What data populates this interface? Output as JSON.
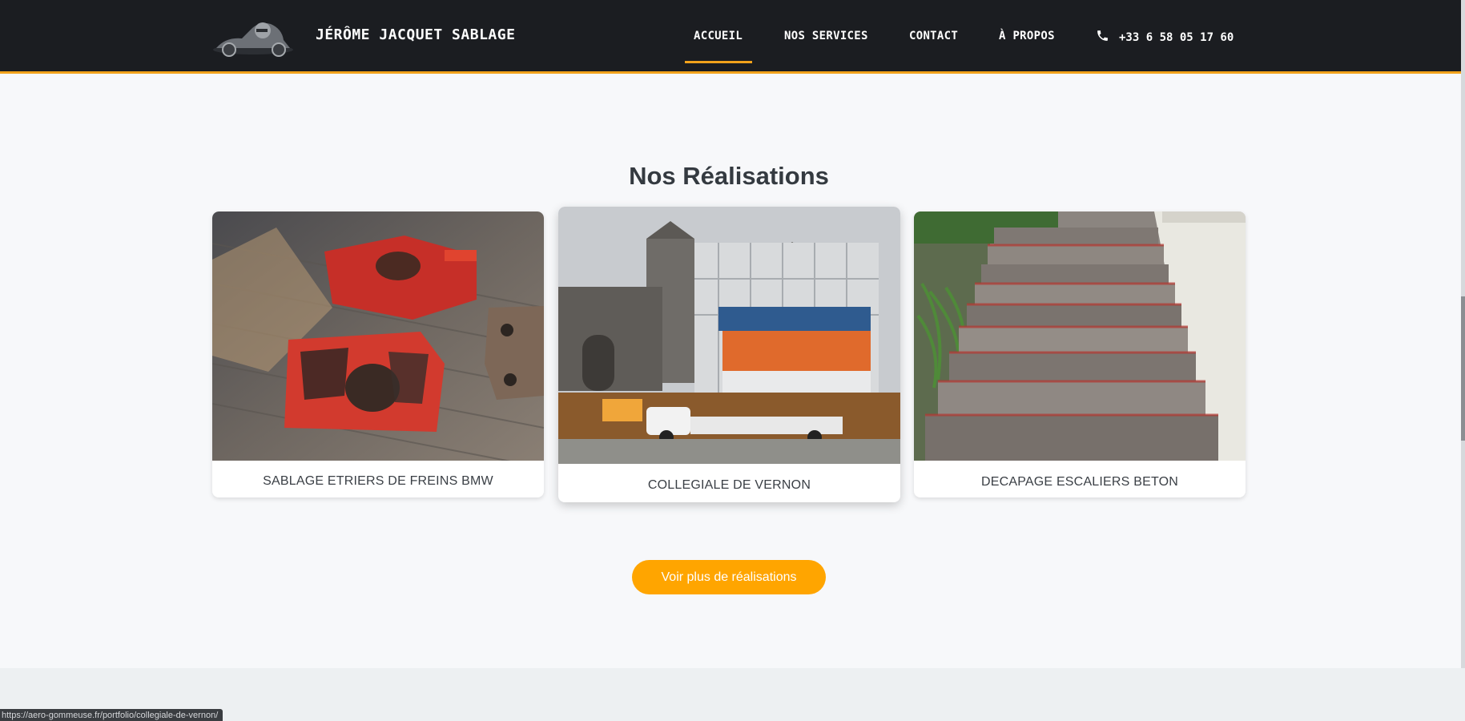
{
  "header": {
    "brand": "JÉRÔME JACQUET SABLAGE",
    "logo_icon": "motorcycle-rider-logo",
    "nav": [
      {
        "label": "ACCUEIL",
        "active": true
      },
      {
        "label": "NOS SERVICES",
        "active": false
      },
      {
        "label": "CONTACT",
        "active": false
      },
      {
        "label": "À PROPOS",
        "active": false
      }
    ],
    "phone": "+33 6 58 05 17 60",
    "phone_icon": "phone-icon",
    "accent_color": "#f2a21b"
  },
  "section": {
    "title": "Nos Réalisations",
    "cards": [
      {
        "caption": "SABLAGE ETRIERS DE FREINS BMW",
        "image": "red-brake-calipers-photo"
      },
      {
        "caption": "COLLEGIALE DE VERNON",
        "image": "scaffolded-church-photo"
      },
      {
        "caption": "DECAPAGE ESCALIERS BETON",
        "image": "concrete-stairs-photo"
      }
    ],
    "more_button": "Voir plus de réalisations",
    "button_color": "#ffa500"
  },
  "status_bar": {
    "url": "https://aero-gommeuse.fr/portfolio/collegiale-de-vernon/"
  }
}
